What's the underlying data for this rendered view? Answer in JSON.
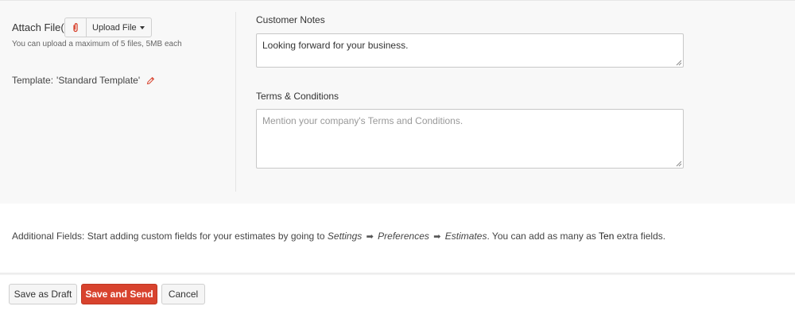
{
  "attach": {
    "label": "Attach File(s)",
    "upload_label": "Upload File",
    "hint": "You can upload a maximum of 5 files, 5MB each"
  },
  "template": {
    "prefix": "Template:",
    "name": "'Standard Template'"
  },
  "customer_notes": {
    "label": "Customer Notes",
    "value": "Looking forward for your business."
  },
  "terms": {
    "label": "Terms & Conditions",
    "placeholder": "Mention your company's Terms and Conditions."
  },
  "additional_fields": {
    "label": "Additional Fields:",
    "text1": "Start adding custom fields for your estimates by going to",
    "path1": "Settings",
    "path2": "Preferences",
    "path3": "Estimates",
    "arrow": "➡",
    "text2": ". You can add as many as",
    "highlight": "Ten",
    "text3": "extra fields."
  },
  "buttons": {
    "draft": "Save as Draft",
    "send": "Save and Send",
    "cancel": "Cancel"
  },
  "colors": {
    "accent": "#d8432e",
    "panel_bg": "#f8f8f8"
  },
  "icons": {
    "attach": "paperclip-icon",
    "edit": "pencil-icon",
    "caret": "caret-down-icon"
  }
}
